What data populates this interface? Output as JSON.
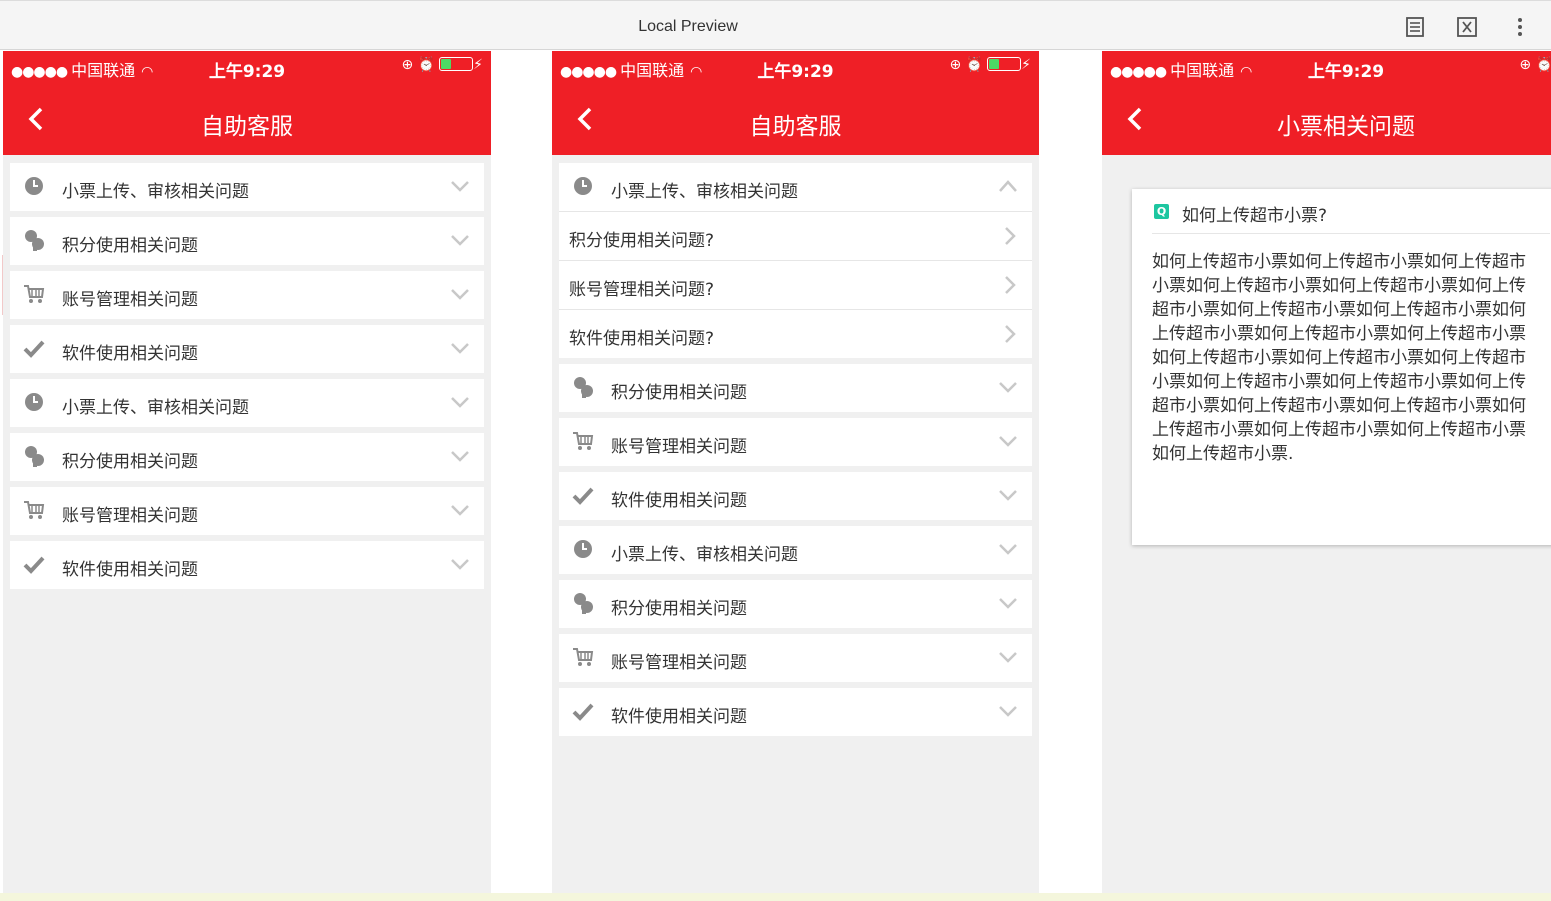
{
  "preview": {
    "title": "Local Preview",
    "icons": [
      "document-icon",
      "x-function-icon",
      "more-vertical-icon"
    ]
  },
  "status": {
    "dots": "●●●●●",
    "carrier": "中国联通",
    "time": "上午9:29"
  },
  "phone1": {
    "title": "自助客服",
    "items": [
      {
        "icon": "clock-icon",
        "label": "小票上传、审核相关问题"
      },
      {
        "icon": "chat-icon",
        "label": "积分使用相关问题"
      },
      {
        "icon": "cart-icon",
        "label": "账号管理相关问题"
      },
      {
        "icon": "check-icon",
        "label": "软件使用相关问题"
      },
      {
        "icon": "clock-icon",
        "label": "小票上传、审核相关问题"
      },
      {
        "icon": "chat-icon",
        "label": "积分使用相关问题"
      },
      {
        "icon": "cart-icon",
        "label": "账号管理相关问题"
      },
      {
        "icon": "check-icon",
        "label": "软件使用相关问题"
      }
    ]
  },
  "phone2": {
    "title": "自助客服",
    "expanded": {
      "label": "小票上传、审核相关问题",
      "subitems": [
        "积分使用相关问题?",
        "账号管理相关问题?",
        "软件使用相关问题?"
      ]
    },
    "items": [
      {
        "icon": "chat-icon",
        "label": "积分使用相关问题"
      },
      {
        "icon": "cart-icon",
        "label": "账号管理相关问题"
      },
      {
        "icon": "check-icon",
        "label": "软件使用相关问题"
      },
      {
        "icon": "clock-icon",
        "label": "小票上传、审核相关问题"
      },
      {
        "icon": "chat-icon",
        "label": "积分使用相关问题"
      },
      {
        "icon": "cart-icon",
        "label": "账号管理相关问题"
      },
      {
        "icon": "check-icon",
        "label": "软件使用相关问题"
      }
    ]
  },
  "phone3": {
    "title": "小票相关问题",
    "question_badge": "Q",
    "question": "如何上传超市小票?",
    "answer": "如何上传超市小票如何上传超市小票如何上传超市小票如何上传超市小票如何上传超市小票如何上传超市小票如何上传超市小票如何上传超市小票如何上传超市小票如何上传超市小票如何上传超市小票如何上传超市小票如何上传超市小票如何上传超市小票如何上传超市小票如何上传超市小票如何上传超市小票如何上传超市小票如何上传超市小票如何上传超市小票如何上传超市小票如何上传超市小票如何上传超市小票."
  },
  "colors": {
    "brand_red": "#ef1f26",
    "badge_green": "#1dc6a0",
    "battery_green": "#4cd964"
  }
}
